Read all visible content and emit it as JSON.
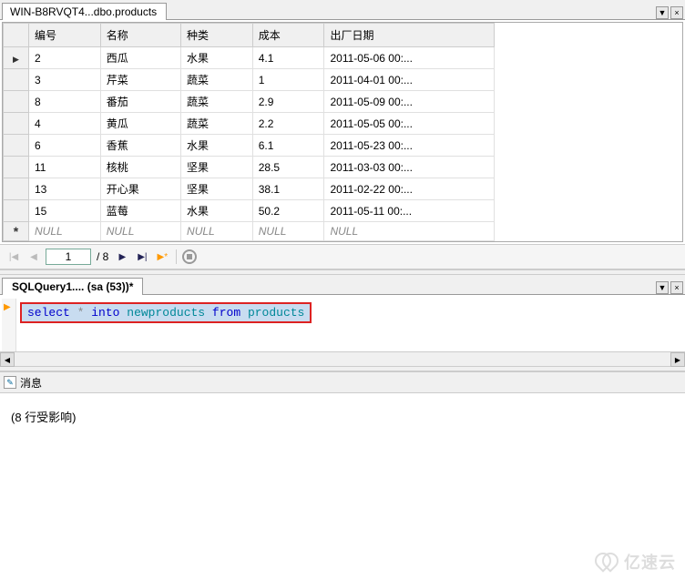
{
  "data_tab": {
    "title": "WIN-B8RVQT4...dbo.products",
    "columns": [
      "编号",
      "名称",
      "种类",
      "成本",
      "出厂日期"
    ],
    "rows": [
      {
        "id": "2",
        "name": "西瓜",
        "kind": "水果",
        "cost": "4.1",
        "date": "2011-05-06 00:..."
      },
      {
        "id": "3",
        "name": "芹菜",
        "kind": "蔬菜",
        "cost": "1",
        "date": "2011-04-01 00:..."
      },
      {
        "id": "8",
        "name": "番茄",
        "kind": "蔬菜",
        "cost": "2.9",
        "date": "2011-05-09 00:..."
      },
      {
        "id": "4",
        "name": "黄瓜",
        "kind": "蔬菜",
        "cost": "2.2",
        "date": "2011-05-05 00:..."
      },
      {
        "id": "6",
        "name": "香蕉",
        "kind": "水果",
        "cost": "6.1",
        "date": "2011-05-23 00:..."
      },
      {
        "id": "11",
        "name": "核桃",
        "kind": "坚果",
        "cost": "28.5",
        "date": "2011-03-03 00:..."
      },
      {
        "id": "13",
        "name": "开心果",
        "kind": "坚果",
        "cost": "38.1",
        "date": "2011-02-22 00:..."
      },
      {
        "id": "15",
        "name": "蓝莓",
        "kind": "水果",
        "cost": "50.2",
        "date": "2011-05-11 00:..."
      }
    ],
    "null_text": "NULL"
  },
  "nav": {
    "current": "1",
    "total": "/ 8"
  },
  "query_tab": {
    "title": "SQLQuery1.... (sa (53))*"
  },
  "sql": {
    "kw_select": "select",
    "star": "*",
    "kw_into": "into",
    "tbl_new": "newproducts",
    "kw_from": "from",
    "tbl_src": "products"
  },
  "messages": {
    "tab_label": "消息",
    "body": "(8 行受影响)"
  },
  "watermark": "亿速云"
}
